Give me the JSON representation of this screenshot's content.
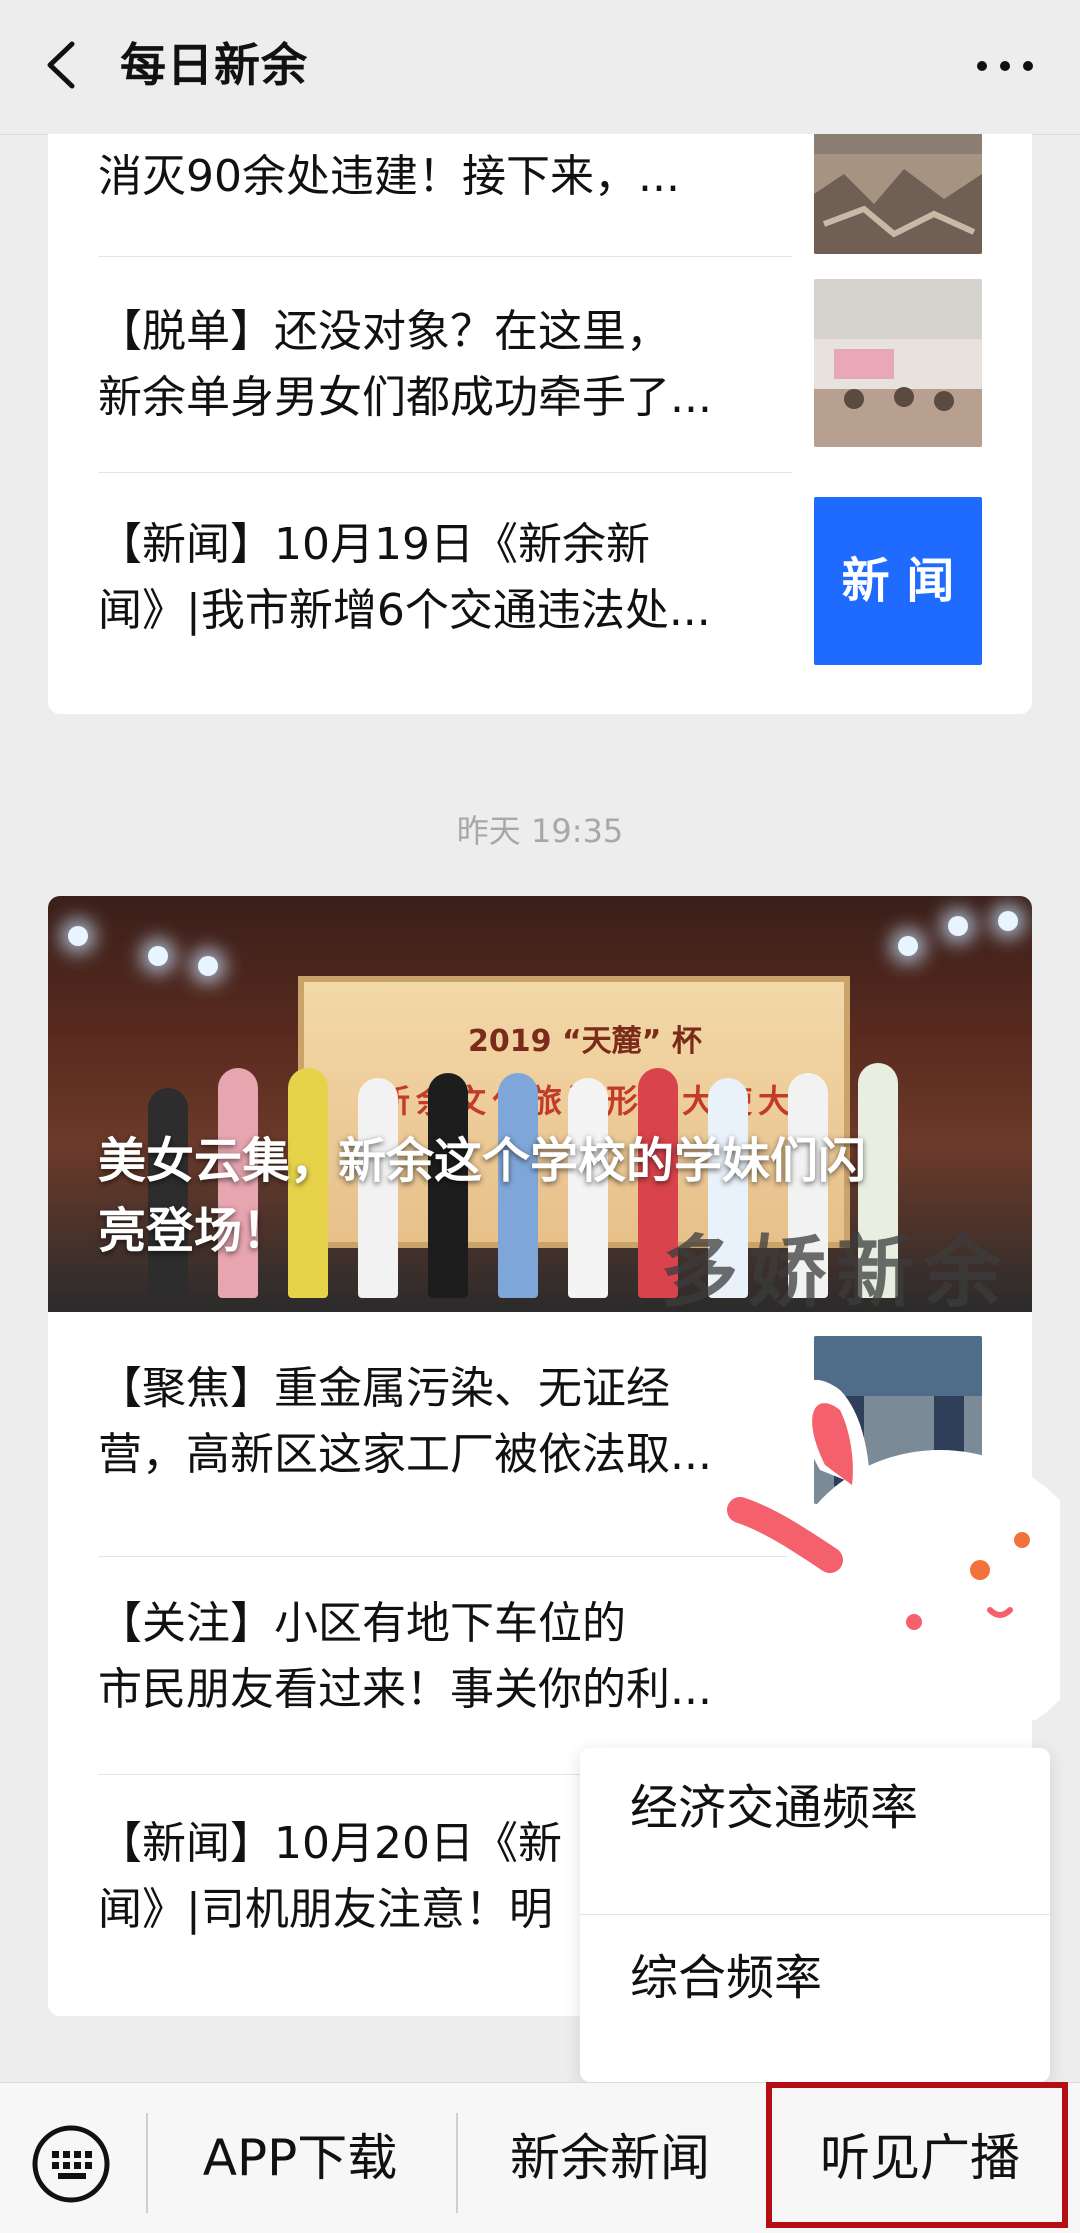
{
  "header": {
    "title": "每日新余"
  },
  "feed": {
    "card1": {
      "items": [
        {
          "lines": [
            "消灭90余处违建！接下来，..."
          ],
          "thumb": "demolition-photo"
        },
        {
          "lines": [
            "【脱单】还没对象？在这里，",
            "新余单身男女们都成功牵手了..."
          ],
          "thumb": "dating-event-photo"
        },
        {
          "lines": [
            "【新闻】10月19日《新余新",
            "闻》|我市新增6个交通违法处..."
          ],
          "thumb_text": "新 闻"
        }
      ]
    },
    "timestamp": "昨天 19:35",
    "card2": {
      "banner": {
        "caption_lines": [
          "美女云集，新余这个学校的学妹们闪",
          "亮登场！"
        ],
        "stage_title": "2019 “天麓” 杯",
        "stage_sub": "新余文化旅游形象大使大赛",
        "watermark": "多娇新余"
      },
      "items": [
        {
          "lines": [
            "【聚焦】重金属污染、无证经",
            "营，高新区这家工厂被依法取..."
          ],
          "thumb": "inspection-photo"
        },
        {
          "lines": [
            "【关注】小区有地下车位的",
            "市民朋友看过来！事关你的利..."
          ]
        },
        {
          "lines": [
            "【新闻】10月20日《新",
            "闻》|司机朋友注意！明"
          ]
        }
      ]
    }
  },
  "popup_menu": {
    "items": [
      "经济交通频率",
      "综合频率"
    ]
  },
  "menubar": {
    "buttons": [
      "APP下载",
      "新余新闻",
      "听见广播"
    ]
  },
  "colors": {
    "highlight": "#b50f15",
    "news_thumb_bg": "#1f6bff"
  }
}
